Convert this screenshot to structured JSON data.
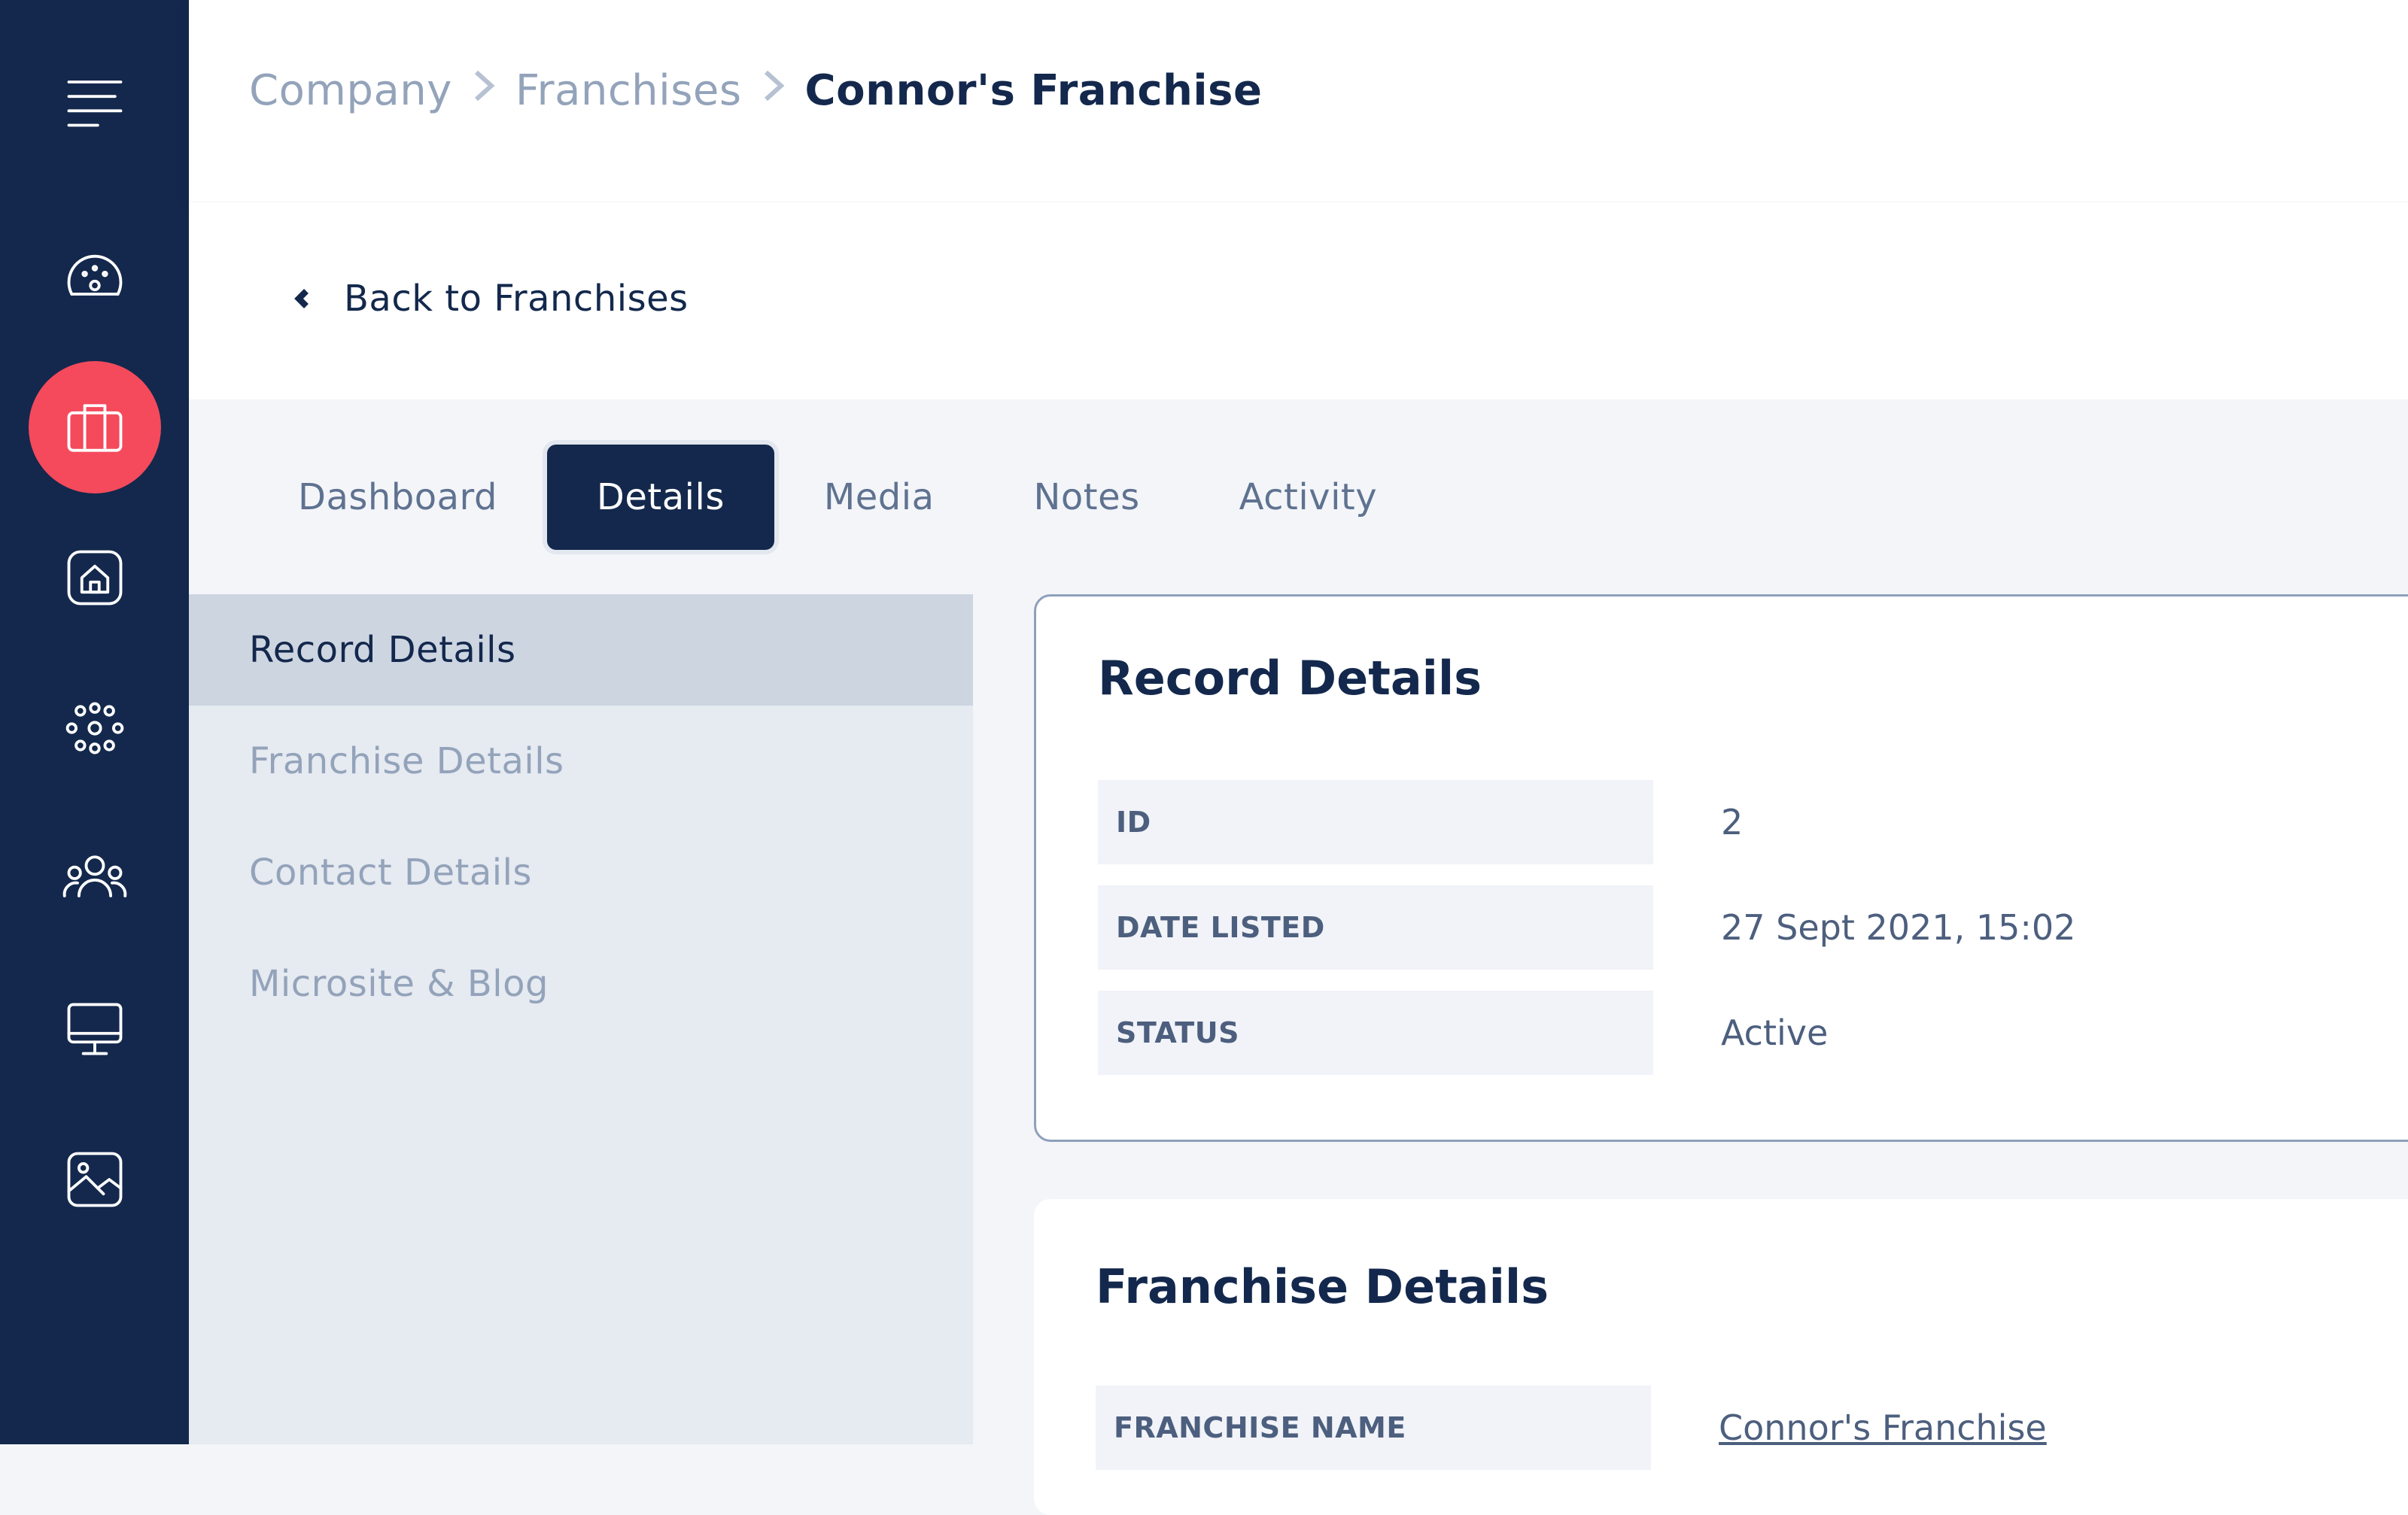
{
  "sidebar": {
    "icons": [
      {
        "name": "menu-icon"
      },
      {
        "name": "dashboard-gauge-icon"
      },
      {
        "name": "briefcase-icon",
        "active": true
      },
      {
        "name": "home-icon"
      },
      {
        "name": "network-icon"
      },
      {
        "name": "users-icon"
      },
      {
        "name": "monitor-icon"
      },
      {
        "name": "image-icon"
      }
    ],
    "active_color": "#f44a5c",
    "background": "#13284c"
  },
  "breadcrumb": {
    "items": [
      "Company",
      "Franchises",
      "Connor's Franchise"
    ]
  },
  "back_link": {
    "label": "Back to Franchises"
  },
  "tabs": {
    "items": [
      "Dashboard",
      "Details",
      "Media",
      "Notes",
      "Activity"
    ],
    "active": "Details"
  },
  "subnav": {
    "items": [
      "Record Details",
      "Franchise Details",
      "Contact Details",
      "Microsite & Blog"
    ],
    "active": "Record Details"
  },
  "record_details": {
    "title": "Record Details",
    "rows": [
      {
        "label": "ID",
        "value": "2"
      },
      {
        "label": "DATE LISTED",
        "value": "27 Sept 2021, 15:02"
      },
      {
        "label": "STATUS",
        "value": "Active"
      }
    ]
  },
  "franchise_details": {
    "title": "Franchise Details",
    "rows": [
      {
        "label": "FRANCHISE NAME",
        "value": "Connor's Franchise"
      }
    ]
  }
}
